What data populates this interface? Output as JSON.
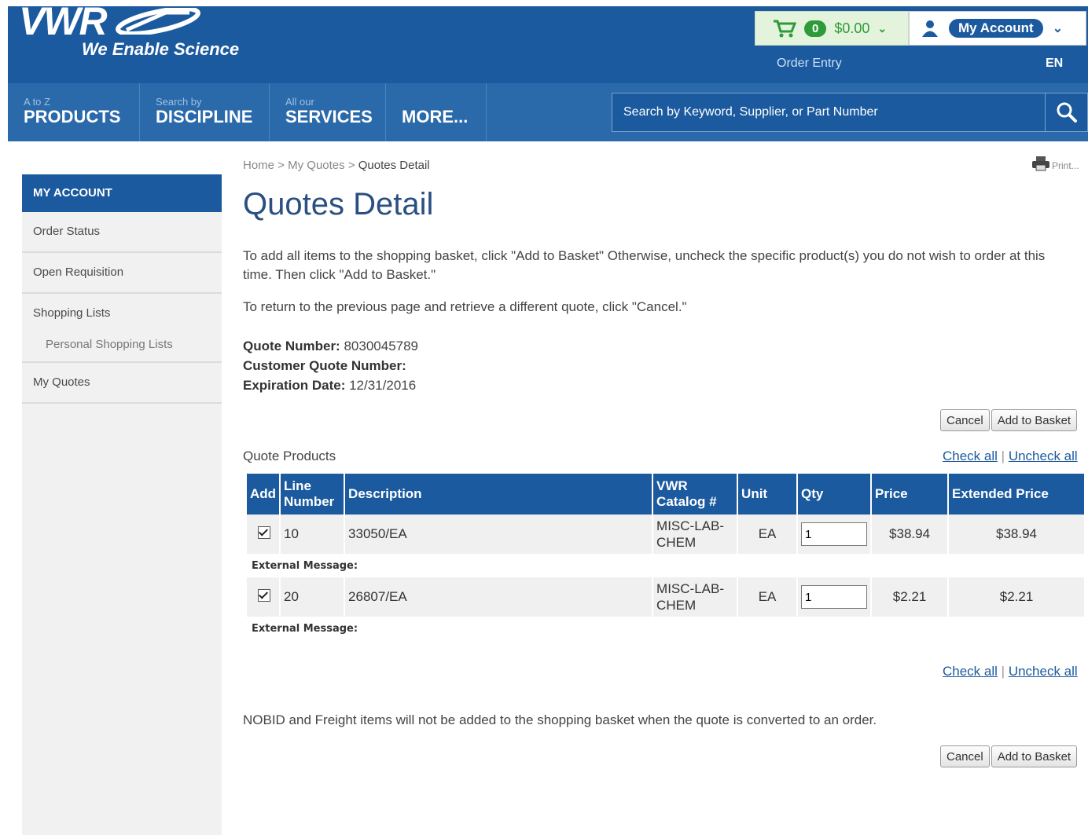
{
  "header": {
    "logo_text": "VWR",
    "tagline": "We Enable Science",
    "cart_count": "0",
    "cart_total": "$0.00",
    "account_label": "My Account",
    "order_entry": "Order Entry",
    "language": "EN"
  },
  "nav": {
    "items": [
      {
        "small": "A to Z",
        "label": "PRODUCTS"
      },
      {
        "small": "Search by",
        "label": "DISCIPLINE"
      },
      {
        "small": "All our",
        "label": "SERVICES"
      },
      {
        "small": "",
        "label": "MORE..."
      }
    ],
    "search_placeholder": "Search by Keyword, Supplier, or Part Number"
  },
  "sidebar": {
    "heading": "MY ACCOUNT",
    "items": [
      "Order Status",
      "Open Requisition",
      "Shopping Lists"
    ],
    "sub_item": "Personal Shopping Lists",
    "last_item": "My Quotes"
  },
  "breadcrumb": {
    "home": "Home",
    "sep": " > ",
    "parent": "My Quotes",
    "current": "Quotes Detail"
  },
  "print_label": "Print...",
  "page_title": "Quotes Detail",
  "instructions": {
    "p1": "To add all items to the shopping basket, click \"Add to Basket\" Otherwise, uncheck the specific product(s) you do not wish to order at this time. Then click \"Add to Basket.\"",
    "p2": "To return to the previous page and retrieve a different quote, click \"Cancel.\""
  },
  "quote": {
    "number_label": "Quote Number:",
    "number": "8030045789",
    "customer_label": "Customer Quote Number:",
    "customer": "",
    "expiration_label": "Expiration Date:",
    "expiration": "12/31/2016"
  },
  "buttons": {
    "cancel": "Cancel",
    "add_to_basket": "Add to Basket"
  },
  "products_label": "Quote Products",
  "links": {
    "check_all": "Check all",
    "separator": "|",
    "uncheck_all": "Uncheck all"
  },
  "table": {
    "headers": [
      "Add",
      "Line Number",
      "Description",
      "VWR Catalog #",
      "Unit",
      "Qty",
      "Price",
      "Extended Price"
    ],
    "rows": [
      {
        "line": "10",
        "description": "33050/EA",
        "catalog": "MISC-LAB-CHEM",
        "unit": "EA",
        "qty": "1",
        "price": "$38.94",
        "extended": "$38.94"
      },
      {
        "line": "20",
        "description": "26807/EA",
        "catalog": "MISC-LAB-CHEM",
        "unit": "EA",
        "qty": "1",
        "price": "$2.21",
        "extended": "$2.21"
      }
    ],
    "external_message_label": "External Message:"
  },
  "footnote": "NOBID and Freight items will not be added to the shopping basket when the quote is converted to an order.",
  "colors": {
    "brand_blue": "#1b5a9e",
    "cart_green": "#2e9a3a"
  }
}
